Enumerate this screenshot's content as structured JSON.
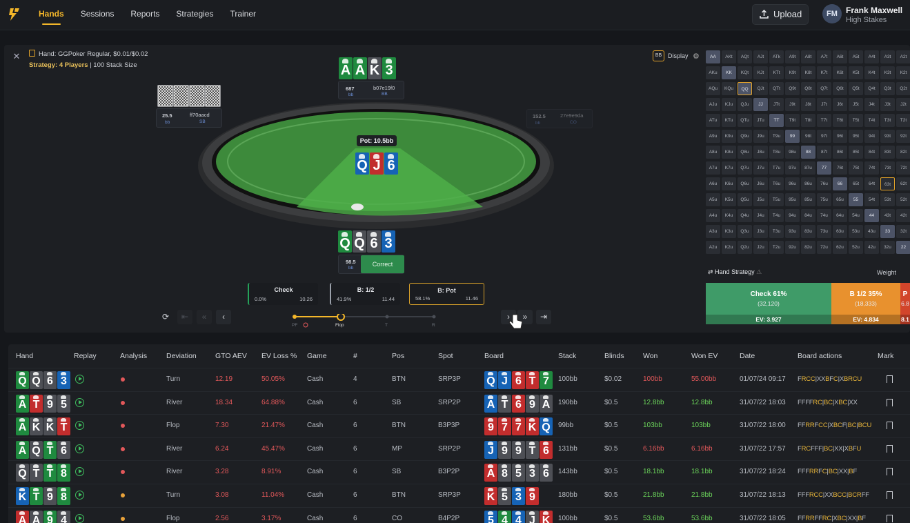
{
  "nav": {
    "items": [
      "Hands",
      "Sessions",
      "Reports",
      "Strategies",
      "Trainer"
    ],
    "active": "Hands"
  },
  "upload": {
    "label": "Upload"
  },
  "user": {
    "initials": "FM",
    "name": "Frank Maxwell",
    "subtitle": "High Stakes"
  },
  "hand": {
    "title": "Hand: GGPoker Regular, $0.01/$0.02",
    "strategy_label": "Strategy: 4 Players",
    "strategy_rest": "| 100 Stack Size"
  },
  "display": {
    "bb": "BB",
    "label": "Display"
  },
  "table": {
    "pot": "Pot: 10.5bb",
    "board": [
      {
        "r": "Q",
        "s": "d"
      },
      {
        "r": "J",
        "s": "h"
      },
      {
        "r": "6",
        "s": "d"
      }
    ],
    "top_hand": [
      {
        "r": "A",
        "s": "c"
      },
      {
        "r": "A",
        "s": "c"
      },
      {
        "r": "K",
        "s": "s"
      },
      {
        "r": "3",
        "s": "c"
      }
    ],
    "hero_hand": [
      {
        "r": "Q",
        "s": "c"
      },
      {
        "r": "Q",
        "s": "s"
      },
      {
        "r": "6",
        "s": "s"
      },
      {
        "r": "3",
        "s": "d"
      }
    ],
    "seats": {
      "top": {
        "stack": "687",
        "unit": "bb",
        "name": "b07e19f0",
        "pos": "BB"
      },
      "left": {
        "stack": "25.5",
        "unit": "bb",
        "name": "ff70aacd",
        "pos": "SB"
      },
      "right": {
        "stack": "152.5",
        "unit": "bb",
        "name": "27e9e9da",
        "pos": "CO"
      },
      "hero": {
        "stack": "98.5",
        "unit": "bb",
        "result": "Correct"
      }
    }
  },
  "actions": [
    {
      "name": "Check",
      "freq": "0.0%",
      "ev": "10.26"
    },
    {
      "name": "B: 1/2",
      "freq": "41.9%",
      "ev": "11.44"
    },
    {
      "name": "B: Pot",
      "freq": "58.1%",
      "ev": "11.46"
    }
  ],
  "timeline": {
    "labels": [
      "PF",
      "Flop",
      "T",
      "R"
    ]
  },
  "range_grid": [
    [
      "AA",
      "AKt",
      "AQt",
      "AJt",
      "ATk",
      "A9t",
      "A8t",
      "A7t",
      "A6t",
      "A5t",
      "A4t",
      "A3t",
      "A2t"
    ],
    [
      "AKu",
      "KK",
      "KQt",
      "KJt",
      "KTt",
      "K9t",
      "K8t",
      "K7t",
      "K6t",
      "K5t",
      "K4t",
      "K3t",
      "K2t"
    ],
    [
      "AQu",
      "KQu",
      "QQ",
      "QJt",
      "QTt",
      "Q9t",
      "Q8t",
      "Q7t",
      "Q6t",
      "Q5t",
      "Q4t",
      "Q3t",
      "Q2t"
    ],
    [
      "AJu",
      "KJu",
      "QJu",
      "JJ",
      "JTt",
      "J9t",
      "J8t",
      "J7t",
      "J6t",
      "J5t",
      "J4t",
      "J3t",
      "J2t"
    ],
    [
      "ATu",
      "KTu",
      "QTu",
      "JTu",
      "TT",
      "T9t",
      "T8t",
      "T7t",
      "T6t",
      "T5t",
      "T4t",
      "T3t",
      "T2t"
    ],
    [
      "A9u",
      "K9u",
      "Q9u",
      "J9u",
      "T9u",
      "99",
      "98t",
      "97t",
      "96t",
      "95t",
      "94t",
      "93t",
      "92t"
    ],
    [
      "A8u",
      "K8u",
      "Q8u",
      "J8u",
      "T8u",
      "98u",
      "88",
      "87t",
      "86t",
      "85t",
      "84t",
      "83t",
      "82t"
    ],
    [
      "A7u",
      "K7u",
      "Q7u",
      "J7u",
      "T7u",
      "97u",
      "87u",
      "77",
      "76t",
      "75t",
      "74t",
      "73t",
      "72t"
    ],
    [
      "A6u",
      "K6u",
      "Q6u",
      "J6u",
      "T6u",
      "96u",
      "86u",
      "76u",
      "66",
      "65t",
      "64t",
      "63t",
      "62t"
    ],
    [
      "A5u",
      "K5u",
      "Q5u",
      "J5u",
      "T5u",
      "95u",
      "85u",
      "75u",
      "65u",
      "55",
      "54t",
      "53t",
      "52t"
    ],
    [
      "A4u",
      "K4u",
      "Q4u",
      "J4u",
      "T4u",
      "94u",
      "84u",
      "74u",
      "64u",
      "54u",
      "44",
      "43t",
      "42t"
    ],
    [
      "A3u",
      "K3u",
      "Q3u",
      "J3u",
      "T3u",
      "93u",
      "83u",
      "73u",
      "63u",
      "53u",
      "43u",
      "33",
      "32t"
    ],
    [
      "A2u",
      "K2u",
      "Q2u",
      "J2u",
      "T2u",
      "92u",
      "82u",
      "72u",
      "62u",
      "52u",
      "42u",
      "32u",
      "22"
    ]
  ],
  "hand_strategy": {
    "title": "Hand Strategy",
    "weight": "Weight",
    "bars": [
      {
        "name": "Check 61%",
        "count": "(32,120)",
        "ev": "EV: 3.927",
        "color": "#3f9b68"
      },
      {
        "name": "B 1/2 35%",
        "count": "(18,333)",
        "ev": "EV: 4.834",
        "color": "#e8912e"
      },
      {
        "name": "P",
        "count": "6.8",
        "ev": "8.1",
        "color": "#d2452b"
      }
    ]
  },
  "columns": [
    "Hand",
    "Replay",
    "Analysis",
    "Deviation",
    "GTO AEV",
    "EV Loss %",
    "Game",
    "#",
    "Pos",
    "Spot",
    "Board",
    "Stack",
    "Blinds",
    "Won",
    "Won EV",
    "Date",
    "Board actions",
    "Mark"
  ],
  "rows": [
    {
      "hand": [
        {
          "r": "Q",
          "s": "c"
        },
        {
          "r": "Q",
          "s": "s"
        },
        {
          "r": "6",
          "s": "s"
        },
        {
          "r": "3",
          "s": "d"
        }
      ],
      "dot": "#e2585a",
      "deviation": "Turn",
      "gto": "12.19",
      "evloss": "50.05%",
      "game": "Cash",
      "n": "4",
      "pos": "BTN",
      "spot": "SRP3P",
      "board": [
        {
          "r": "Q",
          "s": "d"
        },
        {
          "r": "J",
          "s": "d"
        },
        {
          "r": "6",
          "s": "h"
        },
        {
          "r": "T",
          "s": "h"
        },
        {
          "r": "7",
          "s": "c"
        }
      ],
      "stack": "100bb",
      "blinds": "$0.02",
      "won": "100bb",
      "won_class": "red",
      "wonev": "55.00bb",
      "wonev_class": "red",
      "date": "01/07/24 09:17",
      "ba": "FRCC|XXBFC|XBRCU"
    },
    {
      "hand": [
        {
          "r": "A",
          "s": "c"
        },
        {
          "r": "T",
          "s": "h"
        },
        {
          "r": "9",
          "s": "s"
        },
        {
          "r": "5",
          "s": "s"
        }
      ],
      "dot": "#e2585a",
      "deviation": "River",
      "gto": "18.34",
      "evloss": "64.88%",
      "game": "Cash",
      "n": "6",
      "pos": "SB",
      "spot": "SRP2P",
      "board": [
        {
          "r": "A",
          "s": "d"
        },
        {
          "r": "T",
          "s": "s"
        },
        {
          "r": "6",
          "s": "h"
        },
        {
          "r": "9",
          "s": "s"
        },
        {
          "r": "A",
          "s": "s"
        }
      ],
      "stack": "190bb",
      "blinds": "$0.5",
      "won": "12.8bb",
      "won_class": "green",
      "wonev": "12.8bb",
      "wonev_class": "green",
      "date": "31/07/22 18:03",
      "ba": "FFFFRC|BC|XBC|XX"
    },
    {
      "hand": [
        {
          "r": "A",
          "s": "c"
        },
        {
          "r": "K",
          "s": "s"
        },
        {
          "r": "K",
          "s": "s"
        },
        {
          "r": "T",
          "s": "h"
        }
      ],
      "dot": "#e2585a",
      "deviation": "Flop",
      "gto": "7.30",
      "evloss": "21.47%",
      "game": "Cash",
      "n": "6",
      "pos": "BTN",
      "spot": "B3P3P",
      "board": [
        {
          "r": "9",
          "s": "h"
        },
        {
          "r": "7",
          "s": "h"
        },
        {
          "r": "7",
          "s": "h"
        },
        {
          "r": "K",
          "s": "h"
        },
        {
          "r": "Q",
          "s": "d"
        }
      ],
      "stack": "99bb",
      "blinds": "$0.5",
      "won": "103bb",
      "won_class": "green",
      "wonev": "103bb",
      "wonev_class": "green",
      "date": "31/07/22 18:00",
      "ba": "FFRRFCC|XBCF|BC|BCU"
    },
    {
      "hand": [
        {
          "r": "A",
          "s": "c"
        },
        {
          "r": "Q",
          "s": "s"
        },
        {
          "r": "T",
          "s": "c"
        },
        {
          "r": "6",
          "s": "s"
        }
      ],
      "dot": "#e2585a",
      "deviation": "River",
      "gto": "6.24",
      "evloss": "45.47%",
      "game": "Cash",
      "n": "6",
      "pos": "MP",
      "spot": "SRP2P",
      "board": [
        {
          "r": "J",
          "s": "d"
        },
        {
          "r": "9",
          "s": "s"
        },
        {
          "r": "9",
          "s": "s"
        },
        {
          "r": "T",
          "s": "s"
        },
        {
          "r": "6",
          "s": "h"
        }
      ],
      "stack": "131bb",
      "blinds": "$0.5",
      "won": "6.16bb",
      "won_class": "red",
      "wonev": "6.16bb",
      "wonev_class": "red",
      "date": "31/07/22 17:57",
      "ba": "FRCFFF|BC|XX|XBFU"
    },
    {
      "hand": [
        {
          "r": "Q",
          "s": "s"
        },
        {
          "r": "T",
          "s": "s"
        },
        {
          "r": "T",
          "s": "c"
        },
        {
          "r": "8",
          "s": "c"
        }
      ],
      "dot": "#e2585a",
      "deviation": "River",
      "gto": "3.28",
      "evloss": "8.91%",
      "game": "Cash",
      "n": "6",
      "pos": "SB",
      "spot": "B3P2P",
      "board": [
        {
          "r": "A",
          "s": "h"
        },
        {
          "r": "8",
          "s": "s"
        },
        {
          "r": "5",
          "s": "s"
        },
        {
          "r": "3",
          "s": "s"
        },
        {
          "r": "6",
          "s": "s"
        }
      ],
      "stack": "143bb",
      "blinds": "$0.5",
      "won": "18.1bb",
      "won_class": "green",
      "wonev": "18.1bb",
      "wonev_class": "green",
      "date": "31/07/22 18:24",
      "ba": "FFFRRFC|BC|XX|BF"
    },
    {
      "hand": [
        {
          "r": "K",
          "s": "d"
        },
        {
          "r": "T",
          "s": "c"
        },
        {
          "r": "9",
          "s": "s"
        },
        {
          "r": "8",
          "s": "c"
        }
      ],
      "dot": "#e9a23a",
      "deviation": "Turn",
      "gto": "3.08",
      "evloss": "11.04%",
      "game": "Cash",
      "n": "6",
      "pos": "BTN",
      "spot": "SRP3P",
      "board": [
        {
          "r": "K",
          "s": "h"
        },
        {
          "r": "5",
          "s": "s"
        },
        {
          "r": "3",
          "s": "d"
        },
        {
          "r": "9",
          "s": "h"
        }
      ],
      "stack": "180bb",
      "blinds": "$0.5",
      "won": "21.8bb",
      "won_class": "green",
      "wonev": "21.8bb",
      "wonev_class": "green",
      "date": "31/07/22 18:13",
      "ba": "FFFRCC|XXBCC|BCRFF"
    },
    {
      "hand": [
        {
          "r": "A",
          "s": "h"
        },
        {
          "r": "A",
          "s": "s"
        },
        {
          "r": "9",
          "s": "c"
        },
        {
          "r": "4",
          "s": "s"
        }
      ],
      "dot": "#e9a23a",
      "deviation": "Flop",
      "gto": "2.56",
      "evloss": "3.17%",
      "game": "Cash",
      "n": "6",
      "pos": "CO",
      "spot": "B4P2P",
      "board": [
        {
          "r": "5",
          "s": "d"
        },
        {
          "r": "4",
          "s": "c"
        },
        {
          "r": "4",
          "s": "d"
        },
        {
          "r": "J",
          "s": "s"
        },
        {
          "r": "K",
          "s": "h"
        }
      ],
      "stack": "100bb",
      "blinds": "$0.5",
      "won": "53.6bb",
      "won_class": "green",
      "wonev": "53.6bb",
      "wonev_class": "green",
      "date": "31/07/22 18:05",
      "ba": "FFRRFFRC|XBC|XX|BF"
    }
  ]
}
